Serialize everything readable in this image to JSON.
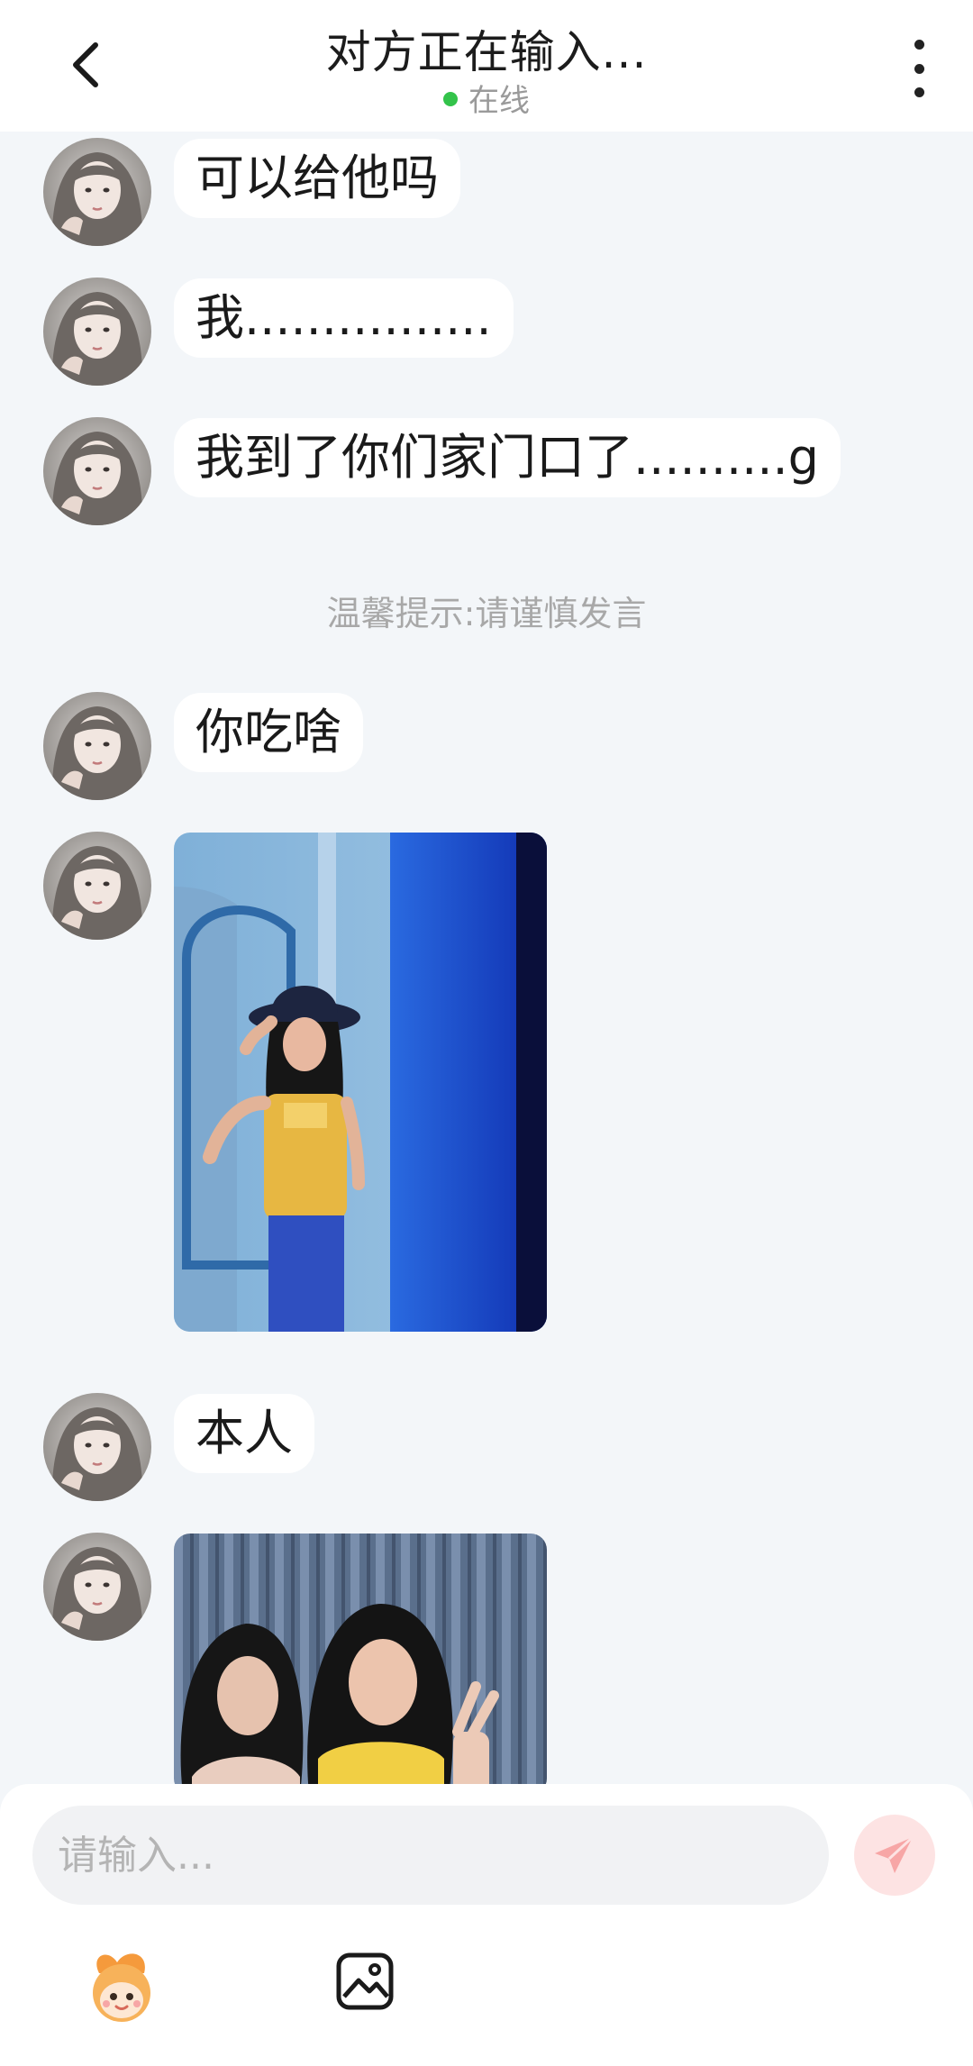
{
  "header": {
    "title": "对方正在输入...",
    "status": "在线",
    "status_color": "#33c34a"
  },
  "messages": [
    {
      "type": "text",
      "text": "可以给他吗"
    },
    {
      "type": "text",
      "text": "我................"
    },
    {
      "type": "text",
      "text": "我到了你们家门口了..........g"
    },
    {
      "type": "notice",
      "text": "温馨提示:请谨慎发言"
    },
    {
      "type": "text",
      "text": "你吃啥"
    },
    {
      "type": "image"
    },
    {
      "type": "text",
      "text": "本人"
    },
    {
      "type": "image"
    }
  ],
  "input": {
    "placeholder": "请输入..."
  },
  "icons": {
    "back": "chevron-left-icon",
    "more": "more-vertical-icon",
    "send": "send-icon",
    "emoji": "emoji-mascot-icon",
    "image": "image-icon"
  },
  "colors": {
    "background": "#f3f6f9",
    "bubble": "#ffffff",
    "send_button": "#fde3e3",
    "send_icon": "#f7a6a6"
  }
}
